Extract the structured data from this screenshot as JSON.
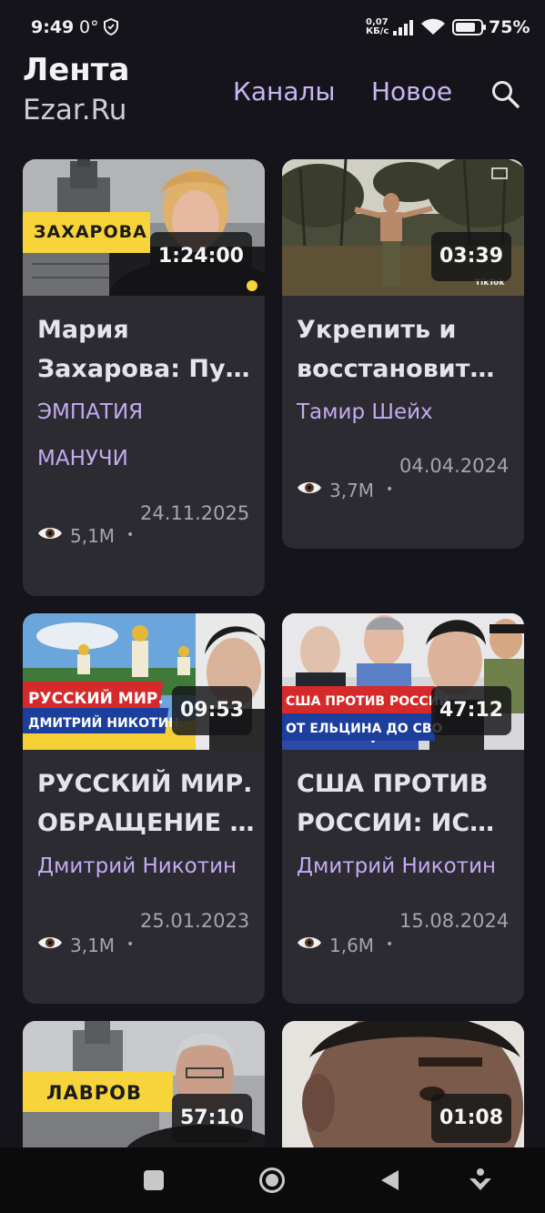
{
  "status_bar": {
    "time": "9:49",
    "temp": "0°",
    "net_speed_value": "0,07",
    "net_speed_unit": "КБ/с",
    "battery": "75%"
  },
  "header": {
    "title": "Лента",
    "subtitle": "Ezar.Ru",
    "nav": [
      "Каналы",
      "Новое"
    ],
    "search_icon": "search-icon"
  },
  "thumbnail_text": {
    "zakharova_banner": "ЗАХАРОВА",
    "russkiy_mir_line1": "РУССКИЙ МИР.",
    "russkiy_mir_line2": "ДМИТРИЙ НИКОТИН.",
    "usa_line1": "США ПРОТИВ РОССИИ",
    "usa_line2": "ОТ ЕЛЬЦИНА ДО СВО",
    "lavrov_banner": "ЛАВРОВ",
    "tiktok_mark": "TikTok"
  },
  "videos": [
    {
      "duration": "1:24:00",
      "title_line1": "Мария",
      "title_line2": "Захарова: Пу…",
      "channel_line1": "ЭМПАТИЯ",
      "channel_line2": "МАНУЧИ",
      "views": "5,1M",
      "date": "24.11.2025"
    },
    {
      "duration": "03:39",
      "title_line1": "Укрепить и",
      "title_line2": "восстановит…",
      "channel_line1": "Тамир Шейх",
      "views": "3,7M",
      "date": "04.04.2024"
    },
    {
      "duration": "09:53",
      "title_line1": "РУССКИЙ МИР.",
      "title_line2": "ОБРАЩЕНИЕ …",
      "channel_line1": "Дмитрий Никотин",
      "views": "3,1M",
      "date": "25.01.2023"
    },
    {
      "duration": "47:12",
      "title_line1": "США ПРОТИВ",
      "title_line2": "РОССИИ: ИС…",
      "channel_line1": "Дмитрий Никотин",
      "views": "1,6M",
      "date": "15.08.2024"
    },
    {
      "duration": "57:10"
    },
    {
      "duration": "01:08"
    }
  ],
  "meta_separator": "•",
  "colors": {
    "background": "#15141a",
    "card": "#2c2b31",
    "accent": "#c9b6f3",
    "banner_yellow": "#f6d43a"
  }
}
